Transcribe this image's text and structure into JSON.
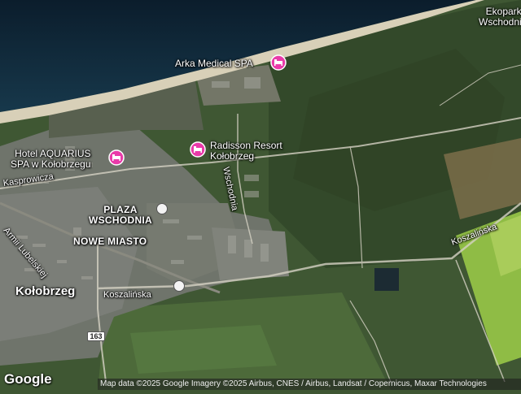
{
  "map": {
    "pois": [
      {
        "name": "Arka Medical SPA",
        "type": "hotel"
      },
      {
        "name": "Radisson Resort",
        "name2": "Kołobrzeg",
        "type": "hotel"
      },
      {
        "name": "Hotel AQUARIUS",
        "name2": "SPA w Kołobrzegu",
        "type": "hotel"
      }
    ],
    "places": {
      "ekopark_1": "Ekopark",
      "ekopark_2": "Wschodni",
      "plaza_1": "PLAZA",
      "plaza_2": "WSCHODNIA",
      "nowe_miasto": "NOWE MIASTO",
      "kolobrzeg": "Kołobrzeg"
    },
    "streets": {
      "kasprowicza": "Kasprowicza",
      "wschodnia": "Wschodnia",
      "koszalinska_east": "Koszalińska",
      "koszalinska_center": "Koszalińska",
      "lubelskiej": "Armii Lubelskiej"
    },
    "road_shield": "163",
    "brand": "Google",
    "attribution": "Map data ©2025 Google Imagery ©2025 Airbus, CNES / Airbus, Landsat / Copernicus, Maxar Technologies",
    "colors": {
      "poi_pin": "#e93aa9",
      "sea": "#0e2538",
      "beach": "#d9d2bd"
    },
    "icons": {
      "poi": "hotel-bed-icon",
      "transit": "bus-stop-icon"
    }
  }
}
